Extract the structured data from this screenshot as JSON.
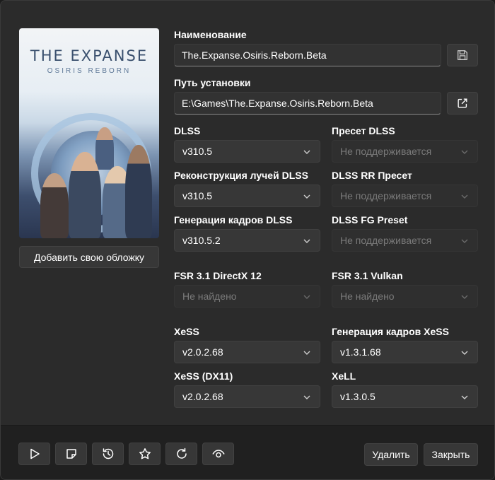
{
  "cover": {
    "title": "THE EXPANSE",
    "subtitle": "OSIRIS REBORN",
    "add_cover_label": "Добавить свою обложку"
  },
  "name": {
    "label": "Наименование",
    "value": "The.Expanse.Osiris.Reborn.Beta",
    "save_icon": "save-icon"
  },
  "path": {
    "label": "Путь установки",
    "value": "E:\\Games\\The.Expanse.Osiris.Reborn.Beta",
    "open_icon": "open-external-icon"
  },
  "settings": {
    "dlss": {
      "label": "DLSS",
      "value": "v310.5"
    },
    "dlss_preset": {
      "label": "Пресет DLSS",
      "value": "Не поддерживается"
    },
    "dlss_rr": {
      "label": "Реконструкция лучей DLSS",
      "value": "v310.5"
    },
    "dlss_rr_preset": {
      "label": "DLSS RR Пресет",
      "value": "Не поддерживается"
    },
    "dlss_fg": {
      "label": "Генерация кадров DLSS",
      "value": "v310.5.2"
    },
    "dlss_fg_preset": {
      "label": "DLSS FG Preset",
      "value": "Не поддерживается"
    },
    "fsr_dx12": {
      "label": "FSR 3.1 DirectX 12",
      "value": "Не найдено"
    },
    "fsr_vulkan": {
      "label": "FSR 3.1 Vulkan",
      "value": "Не найдено"
    },
    "xess": {
      "label": "XeSS",
      "value": "v2.0.2.68"
    },
    "xess_fg": {
      "label": "Генерация кадров XeSS",
      "value": "v1.3.1.68"
    },
    "xess_dx11": {
      "label": "XeSS (DX11)",
      "value": "v2.0.2.68"
    },
    "xell": {
      "label": "XeLL",
      "value": "v1.3.0.5"
    }
  },
  "footer": {
    "icons": [
      "play-icon",
      "note-icon",
      "history-icon",
      "star-icon",
      "refresh-icon",
      "eye-icon"
    ],
    "delete_label": "Удалить",
    "close_label": "Закрыть"
  },
  "colors": {
    "background": "#2b2b2b",
    "footer": "#202020",
    "field": "#323232",
    "button": "#373737",
    "disabled_text": "#7a7a7a"
  }
}
